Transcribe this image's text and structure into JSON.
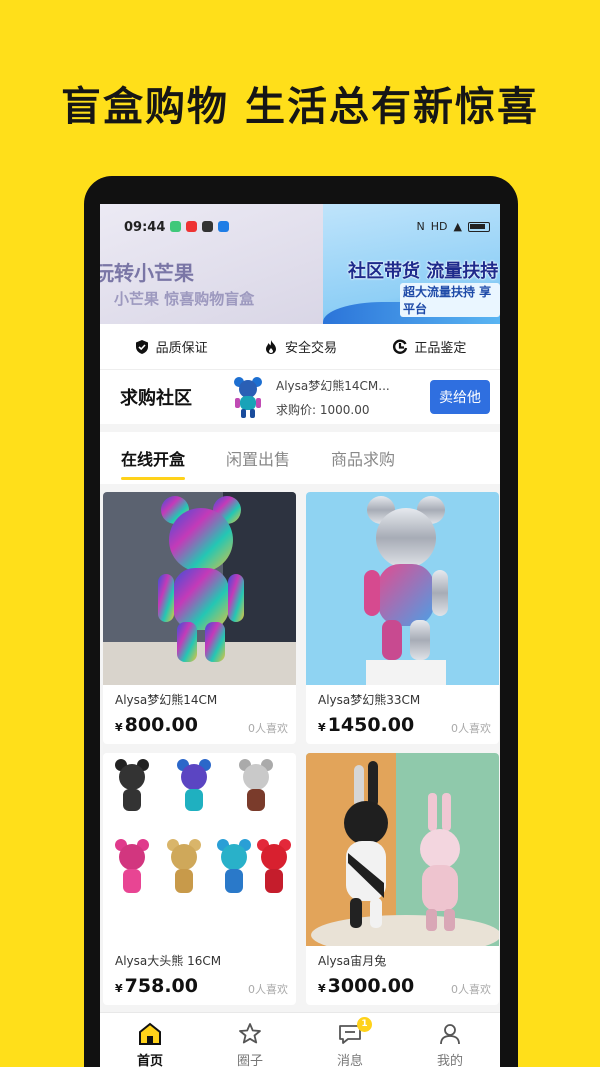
{
  "promo": {
    "title": "盲盒购物 生活总有新惊喜"
  },
  "status_bar": {
    "time": "09:44",
    "right": "HD"
  },
  "banner": {
    "left_title": "玩转小芒果",
    "left_subtitle": "小芒果 惊喜购物盲盒",
    "right_title": "社区带货 流量扶持",
    "right_subtitle": "超大流量扶持 享平台"
  },
  "guarantees": [
    {
      "label": "品质保证",
      "icon": "shield-check-icon"
    },
    {
      "label": "安全交易",
      "icon": "flame-icon"
    },
    {
      "label": "正品鉴定",
      "icon": "authenticate-icon"
    }
  ],
  "wanted": {
    "title": "求购社区",
    "item_name": "Alysa梦幻熊14CM...",
    "price": "求购价: 1000.00",
    "button": "卖给他"
  },
  "tabs": [
    {
      "label": "在线开盒",
      "active": true
    },
    {
      "label": "闲置出售",
      "active": false
    },
    {
      "label": "商品求购",
      "active": false
    }
  ],
  "products": [
    {
      "name": "Alysa梦幻熊14CM",
      "yen": "¥",
      "price": "800.00",
      "likes": "0人喜欢"
    },
    {
      "name": "Alysa梦幻熊33CM",
      "yen": "¥",
      "price": "1450.00",
      "likes": "0人喜欢"
    },
    {
      "name": "Alysa大头熊 16CM",
      "yen": "¥",
      "price": "758.00",
      "likes": "0人喜欢"
    },
    {
      "name": "Alysa宙月兔",
      "yen": "¥",
      "price": "3000.00",
      "likes": "0人喜欢"
    }
  ],
  "nav": [
    {
      "label": "首页",
      "icon": "home-icon",
      "active": true
    },
    {
      "label": "圈子",
      "icon": "star-icon",
      "active": false
    },
    {
      "label": "消息",
      "icon": "message-icon",
      "active": false,
      "badge": "1"
    },
    {
      "label": "我的",
      "icon": "user-icon",
      "active": false
    }
  ],
  "colors": {
    "background": "#ffdf1a",
    "accent": "#ffd21a",
    "button": "#2f6fe0"
  }
}
